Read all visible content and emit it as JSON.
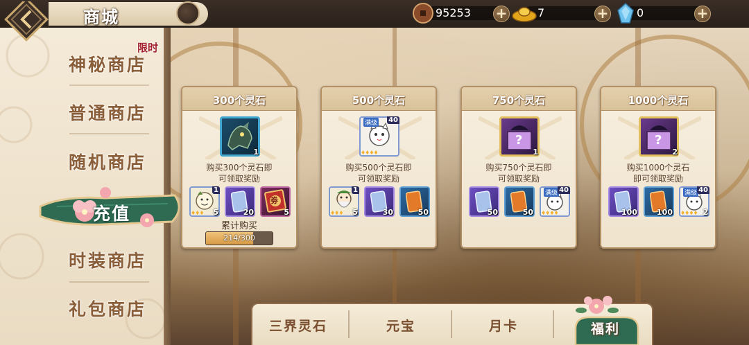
{
  "header": {
    "title": "商城",
    "currencies": [
      {
        "name": "copper-coin",
        "value": "95253"
      },
      {
        "name": "gold-ingot",
        "value": "7"
      },
      {
        "name": "spirit-crystal",
        "value": "0"
      }
    ],
    "plus_label": "+"
  },
  "sidebar": {
    "items": [
      {
        "label": "神秘商店",
        "tag": "限时"
      },
      {
        "label": "普通商店"
      },
      {
        "label": "随机商店"
      },
      {
        "label": "充值",
        "active": true
      },
      {
        "label": "时装商店"
      },
      {
        "label": "礼包商店"
      }
    ]
  },
  "packs": [
    {
      "title": "300个灵石",
      "big_item": {
        "icon": "dragon-beast-icon",
        "count": "1"
      },
      "desc_1": "购买300个灵石即",
      "desc_2": "可领取奖励",
      "items": [
        {
          "icon": "cartoon-character-icon",
          "qty": "5",
          "corner": "1"
        },
        {
          "icon": "blue-card-icon",
          "qty": "20"
        },
        {
          "icon": "red-ticket-icon",
          "qty": "5",
          "glyph": "劵"
        }
      ],
      "cumulative_label": "累计购买",
      "progress_text": "214/300",
      "progress_fraction": 0.713
    },
    {
      "title": "500个灵石",
      "big_item": {
        "icon": "white-cat-character-icon",
        "tag": "满级",
        "count": "40"
      },
      "desc_1": "购买500个灵石即",
      "desc_2": "可领取奖励",
      "items": [
        {
          "icon": "bearded-character-icon",
          "qty": "5",
          "corner": "1"
        },
        {
          "icon": "blue-card-icon",
          "qty": "30"
        },
        {
          "icon": "orange-card-icon",
          "qty": "50"
        }
      ]
    },
    {
      "title": "750个灵石",
      "big_item": {
        "icon": "mystery-box-icon",
        "count": "1"
      },
      "desc_1": "购买750个灵石即",
      "desc_2": "可领取奖励",
      "items": [
        {
          "icon": "blue-card-icon",
          "qty": "50"
        },
        {
          "icon": "orange-card-icon",
          "qty": "50"
        },
        {
          "icon": "white-cat-character-icon",
          "tag": "满级",
          "corner": "40"
        }
      ]
    },
    {
      "title": "1000个灵石",
      "big_item": {
        "icon": "mystery-box-icon",
        "count": "2"
      },
      "desc_1": "购买1000个灵石",
      "desc_2": "即可领取奖励",
      "items": [
        {
          "icon": "blue-card-icon",
          "qty": "100"
        },
        {
          "icon": "orange-card-icon",
          "qty": "100"
        },
        {
          "icon": "white-cat-character-icon",
          "tag": "满级",
          "qty": "2",
          "corner": "40"
        }
      ]
    }
  ],
  "bottom_tabs": [
    {
      "label": "三界灵石"
    },
    {
      "label": "元宝"
    },
    {
      "label": "月卡"
    },
    {
      "label": "福利",
      "active": true
    }
  ],
  "colors": {
    "accent_green": "#2f6b52",
    "brown_text": "#8b5e3a",
    "limited_red": "#a3212b",
    "progress_fill": "#d69a45"
  }
}
